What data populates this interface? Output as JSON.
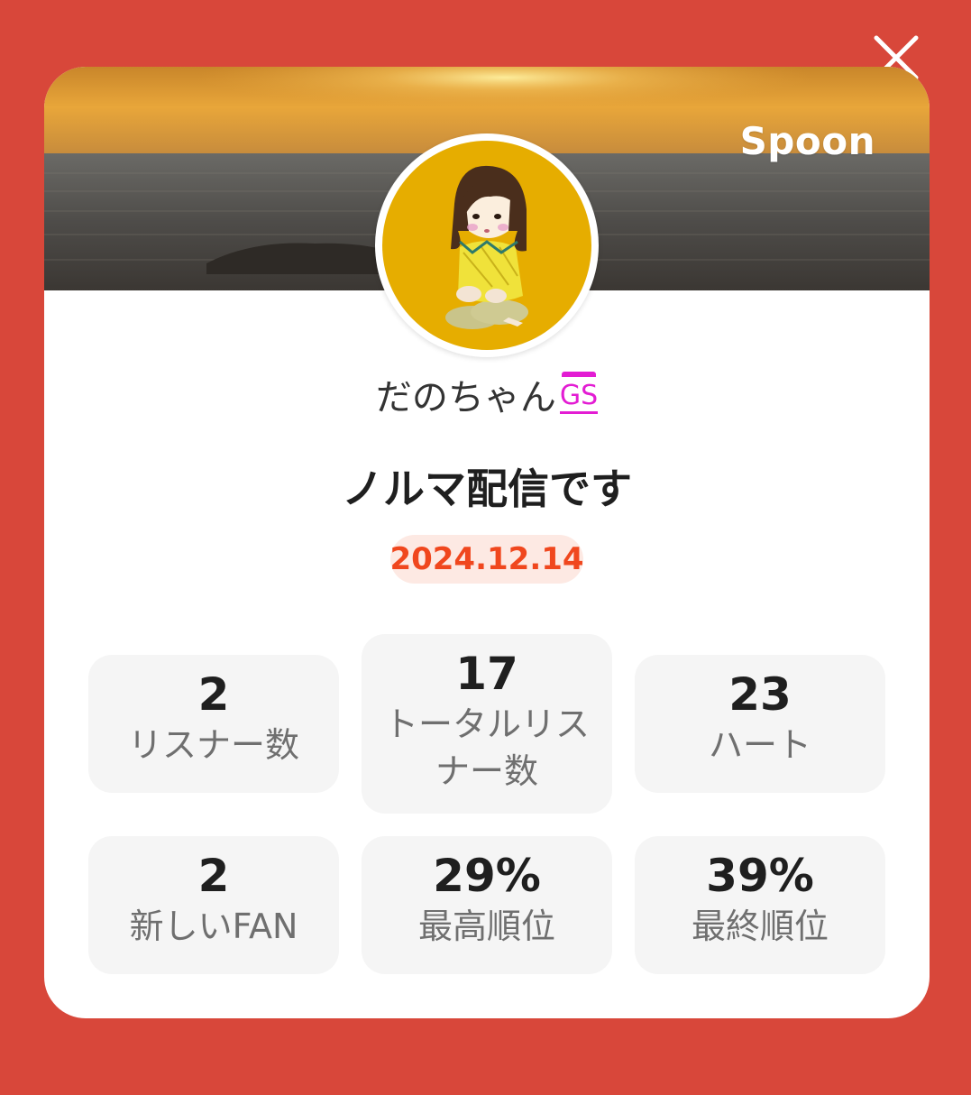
{
  "header": {
    "brand": "Spoon",
    "close_icon": "close-icon"
  },
  "profile": {
    "username": "だのちゃん",
    "badge": "GS"
  },
  "broadcast": {
    "title": "ノルマ配信です",
    "date": "2024.12.14"
  },
  "stats": [
    {
      "value": "2",
      "label": "リスナー数"
    },
    {
      "value": "17",
      "label_line1": "トータルリス",
      "label_line2": "ナー数"
    },
    {
      "value": "23",
      "label": "ハート"
    },
    {
      "value": "2",
      "label": "新しいFAN"
    },
    {
      "value": "29%",
      "label": "最高順位"
    },
    {
      "value": "39%",
      "label": "最終順位"
    }
  ],
  "colors": {
    "background": "#d8473a",
    "date_text": "#f0471e",
    "date_badge": "#fde9e3",
    "gs_badge": "#e31cd3",
    "avatar_bg": "#e6ad00"
  }
}
